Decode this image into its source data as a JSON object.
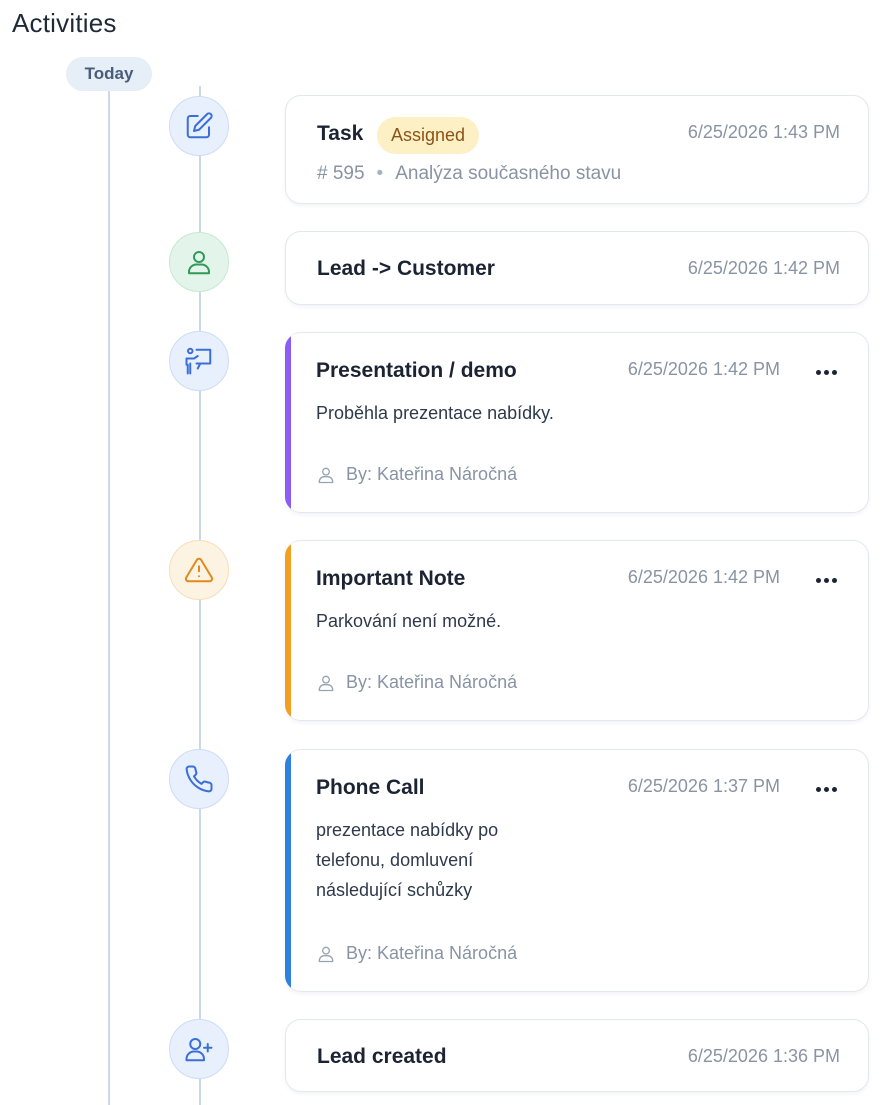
{
  "page": {
    "title": "Activities"
  },
  "timeline": {
    "date_label": "Today"
  },
  "colors": {
    "presentation": "#8b5cf6",
    "important": "#f29f1f",
    "phone": "#2f7fe0",
    "badge_bg": "#fdf0c4"
  },
  "activities": [
    {
      "icon": "edit-icon",
      "title": "Task",
      "badge": "Assigned",
      "time": "6/25/2026 1:43 PM",
      "number": "# 595",
      "subject": "Analýza současného stavu"
    },
    {
      "icon": "user-icon",
      "title": "Lead -> Customer",
      "time": "6/25/2026 1:42 PM"
    },
    {
      "icon": "presentation-icon",
      "title": "Presentation / demo",
      "time": "6/25/2026 1:42 PM",
      "description": "Proběhla prezentace nabídky.",
      "author": "By: Kateřina Náročná"
    },
    {
      "icon": "warning-icon",
      "title": "Important Note",
      "time": "6/25/2026 1:42 PM",
      "description": "Parkování není možné.",
      "author": "By: Kateřina Náročná"
    },
    {
      "icon": "phone-icon",
      "title": "Phone Call",
      "time": "6/25/2026 1:37 PM",
      "description": "prezentace nabídky po\ntelefonu, domluvení\nnásledující schůzky",
      "author": "By: Kateřina Náročná"
    },
    {
      "icon": "user-plus-icon",
      "title": "Lead created",
      "time": "6/25/2026 1:36 PM"
    }
  ]
}
